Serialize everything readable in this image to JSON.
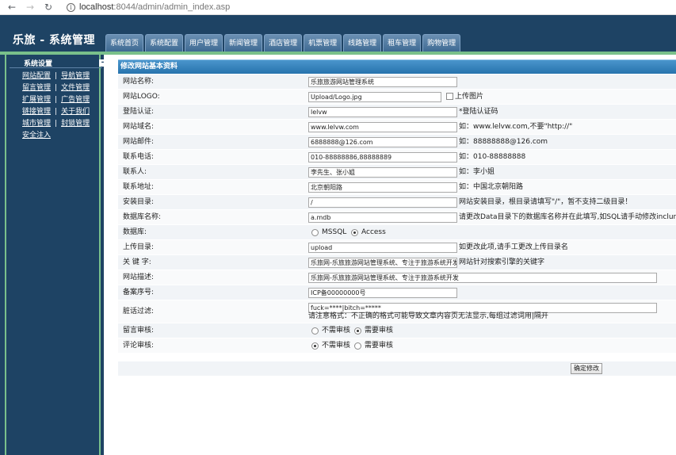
{
  "browser": {
    "url_host": "localhost",
    "url_rest": ":8044/admin/admin_index.asp"
  },
  "header": {
    "title": "乐旅 - 系统管理",
    "tabs": [
      "系统首页",
      "系统配置",
      "用户管理",
      "新闻管理",
      "酒店管理",
      "机票管理",
      "线路管理",
      "租车管理",
      "购物管理"
    ]
  },
  "sidebar": {
    "heading": "系统设置",
    "toggle": "-",
    "separator": "|",
    "rows": [
      [
        "网站配置",
        "导航管理"
      ],
      [
        "留言管理",
        "文件管理"
      ],
      [
        "扩展管理",
        "广告管理"
      ],
      [
        "链接管理",
        "关于我们"
      ],
      [
        "城市管理",
        "封锁管理"
      ],
      [
        "安全注入"
      ]
    ]
  },
  "panel": {
    "title": "修改网站基本资料"
  },
  "form": {
    "site_name": {
      "label": "网站名称:",
      "value": "乐旅旅游网站管理系统"
    },
    "logo": {
      "label": "网站LOGO:",
      "value": "Upload/Logo.jpg",
      "upload_label": "上传图片"
    },
    "login_code": {
      "label": "登陆认证:",
      "value": "lelvw",
      "hint": "*登陆认证码"
    },
    "domain": {
      "label": "网站域名:",
      "value": "www.lelvw.com",
      "hint": "如：www.lelvw.com,不要\"http://\""
    },
    "email": {
      "label": "网站邮件:",
      "value": "6888888@126.com",
      "hint": "如：88888888@126.com"
    },
    "phone": {
      "label": "联系电话:",
      "value": "010-88888886,88888889",
      "hint": "如：010-88888888"
    },
    "contact": {
      "label": "联系人:",
      "value": "李先生、张小姐",
      "hint": "如：李小姐"
    },
    "address": {
      "label": "联系地址:",
      "value": "北京朝阳路",
      "hint": "如：中国北京朝阳路"
    },
    "install_dir": {
      "label": "安装目录:",
      "value": "/",
      "hint": "网站安装目录，根目录请填写\"/\"，暂不支持二级目录！"
    },
    "db_name": {
      "label": "数据库名称:",
      "value": "a.mdb",
      "hint": "请更改Data目录下的数据库名称并在此填写,如SQL请手动修改inclunde/c"
    },
    "db_type": {
      "label": "数据库:",
      "opt1": "MSSQL",
      "opt2": "Access",
      "selected": "Access"
    },
    "upload_dir": {
      "label": "上传目录:",
      "value": "upload",
      "hint": "如更改此项,请手工更改上传目录名"
    },
    "keywords": {
      "label": "关 键 字:",
      "value": "乐旅网-乐旅旅游网站管理系统、专注于旅游系统开发",
      "hint": "网站针对搜索引擎的关键字"
    },
    "description": {
      "label": "网站描述:",
      "value": "乐旅网-乐旅旅游网站管理系统、专注于旅游系统开发"
    },
    "icp": {
      "label": "备案序号:",
      "value": "ICP备00000000号"
    },
    "filter": {
      "label": "脏话过滤:",
      "value": "fuck=****|bitch=*****",
      "hint": "请注意格式：不正确的格式可能导致文章内容页无法显示,每组过滤词用|隔开"
    },
    "msg_audit": {
      "label": "留言审核:",
      "opt1": "不需审核",
      "opt2": "需要审核",
      "selected": "需要审核"
    },
    "comment_audit": {
      "label": "评论审核:",
      "opt1": "不需审核",
      "opt2": "需要审核",
      "selected": "不需审核"
    }
  },
  "submit": {
    "label": "确定修改"
  }
}
